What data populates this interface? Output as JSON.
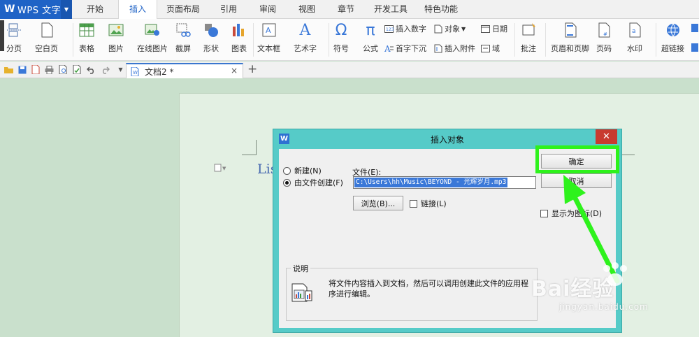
{
  "app": {
    "name": "WPS 文字"
  },
  "menus": [
    {
      "label": "开始"
    },
    {
      "label": "插入"
    },
    {
      "label": "页面布局"
    },
    {
      "label": "引用"
    },
    {
      "label": "审阅"
    },
    {
      "label": "视图"
    },
    {
      "label": "章节"
    },
    {
      "label": "开发工具"
    },
    {
      "label": "特色功能"
    }
  ],
  "active_menu": "插入",
  "ribbon": {
    "page_break": "分页",
    "blank_page": "空白页",
    "table": "表格",
    "picture": "图片",
    "online_picture": "在线图片",
    "screenshot": "截屏",
    "shape": "形状",
    "chart": "图表",
    "text_box": "文本框",
    "word_art": "艺术字",
    "symbol": "符号",
    "formula": "公式",
    "insert_number": "插入数字",
    "object": "对象",
    "date": "日期",
    "drop_cap": "首字下沉",
    "insert_attachment": "插入附件",
    "field": "域",
    "comment": "批注",
    "header_footer": "页眉和页脚",
    "page_number": "页码",
    "watermark": "水印",
    "hyperlink": "超链接"
  },
  "doc_tab": {
    "name": "文档2 *",
    "close": "×",
    "new": "+"
  },
  "page_text": "Lis",
  "dialog": {
    "title": "插入对象",
    "close": "✕",
    "radio_new": "新建(N)",
    "radio_from_file": "由文件创建(F)",
    "file_label": "文件(E):",
    "file_value": "C:\\Users\\hh\\Music\\BEYOND - 光辉岁月.mp3",
    "browse": "浏览(B)...",
    "link": "链接(L)",
    "ok": "确定",
    "cancel": "取消",
    "display_as_icon": "显示为图标(D)",
    "desc_label": "说明",
    "desc_text": "将文件内容插入到文档，然后可以调用创建此文件的应用程序进行编辑。"
  },
  "watermark": {
    "brand": "Bai经验",
    "url": "jingyan.baidu.com"
  },
  "colors": {
    "accent": "#1f63c6",
    "dialog": "#56cbc8",
    "highlight": "#2ef21c",
    "close": "#c83a30"
  }
}
